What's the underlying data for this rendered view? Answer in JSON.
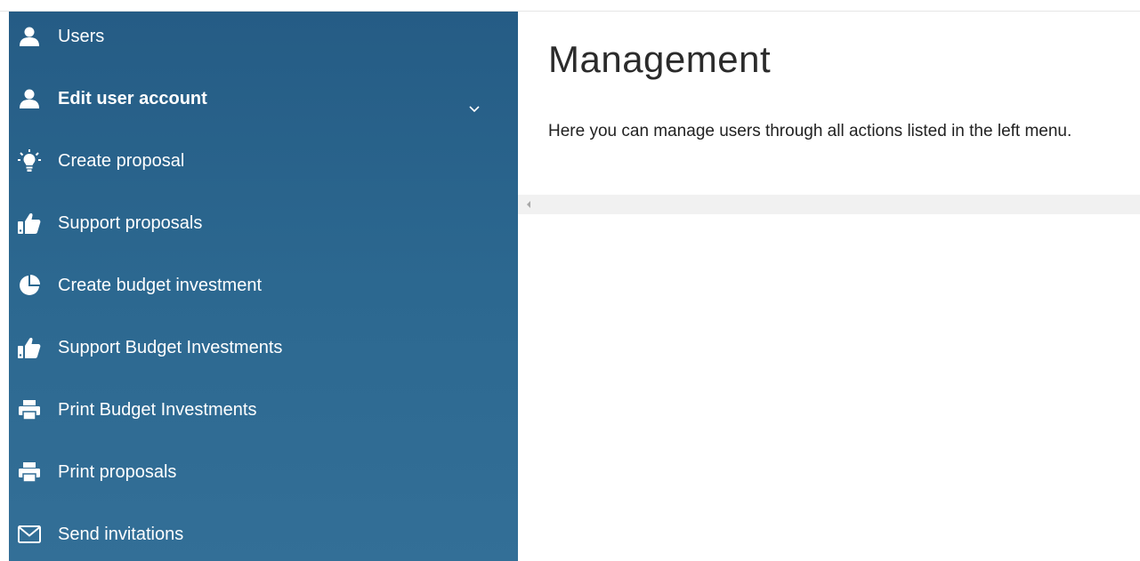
{
  "main": {
    "title": "Management",
    "description": "Here you can manage users through all actions listed in the left menu."
  },
  "sidebar": {
    "items": [
      {
        "label": "Users",
        "icon": "user-icon"
      },
      {
        "label": "Edit user account",
        "icon": "user-icon",
        "expanded_indicator": "chevron-down-icon"
      },
      {
        "label": "Create proposal",
        "icon": "lightbulb-icon"
      },
      {
        "label": "Support proposals",
        "icon": "thumbs-up-icon"
      },
      {
        "label": "Create budget investment",
        "icon": "pie-chart-icon"
      },
      {
        "label": "Support Budget Investments",
        "icon": "thumbs-up-icon"
      },
      {
        "label": "Print Budget Investments",
        "icon": "printer-icon"
      },
      {
        "label": "Print proposals",
        "icon": "printer-icon"
      },
      {
        "label": "Send invitations",
        "icon": "envelope-icon"
      }
    ]
  },
  "colors": {
    "sidebar_top": "#255c85",
    "sidebar_bottom": "#336f97",
    "menu_text": "#ffffff",
    "title_text": "#2b2b2b",
    "scrollbar_track": "#f1f1f1"
  }
}
